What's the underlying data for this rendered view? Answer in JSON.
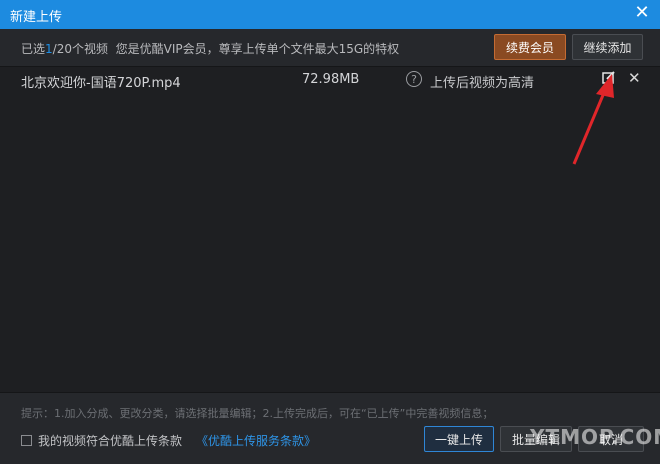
{
  "window": {
    "title": "新建上传"
  },
  "info": {
    "selected_prefix": "已选",
    "selected_count": "1",
    "selected_suffix": "/20个视频",
    "membership_note": "您是优酷VIP会员，尊享上传单个文件最大15G的特权",
    "renew_label": "续费会员",
    "add_more_label": "继续添加"
  },
  "files": [
    {
      "name": "北京欢迎你-国语720P.mp4",
      "size": "72.98MB",
      "quality_note": "上传后视频为高清"
    }
  ],
  "footer": {
    "tip": "提示：1.加入分成、更改分类，请选择批量编辑；2.上传完成后，可在“已上传”中完善视频信息；",
    "agreement_text": "我的视频符合优酷上传条款",
    "agreement_link": "《优酷上传服务条款》",
    "upload_label": "一键上传",
    "batch_edit_label": "批量编辑",
    "cancel_label": "取消"
  },
  "watermark": "YTMOP.COM",
  "colors": {
    "title_bar": "#1d8be0",
    "accent": "#1e8fe6",
    "vip_button": "#8a4a22",
    "annotation_arrow": "#e0262a"
  },
  "icons": [
    "close-icon",
    "help-icon",
    "edit-icon",
    "delete-icon",
    "checkbox-icon"
  ]
}
